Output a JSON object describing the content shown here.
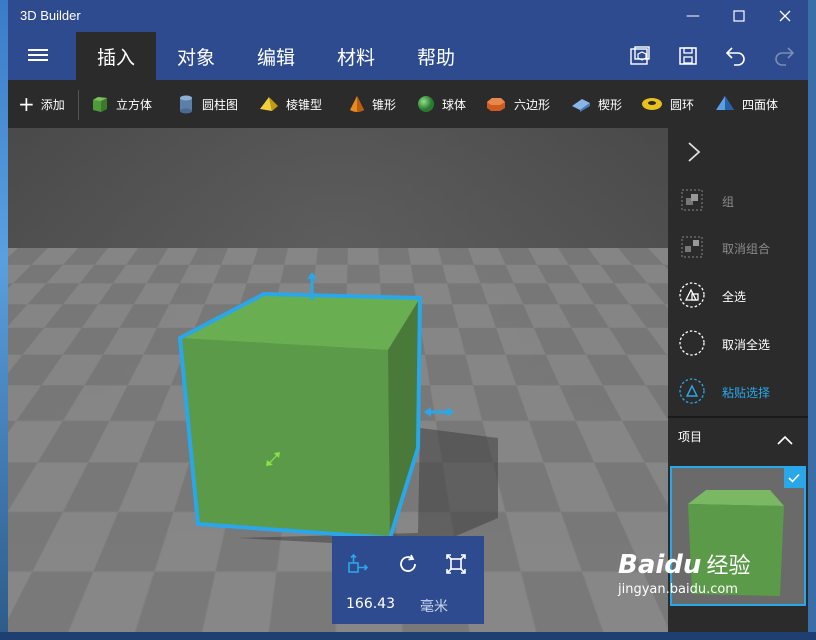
{
  "window": {
    "title": "3D Builder"
  },
  "menu": {
    "tabs": [
      {
        "label": "插入",
        "active": true
      },
      {
        "label": "对象",
        "active": false
      },
      {
        "label": "编辑",
        "active": false
      },
      {
        "label": "材料",
        "active": false
      },
      {
        "label": "帮助",
        "active": false
      }
    ]
  },
  "toolbar": {
    "add_label": "添加",
    "shapes": [
      {
        "label": "立方体",
        "icon": "cube-icon",
        "color": "#4f9a3a"
      },
      {
        "label": "圆柱图",
        "icon": "cylinder-icon",
        "color": "#5b7fa8"
      },
      {
        "label": "棱锥型",
        "icon": "pyramid-icon",
        "color": "#e8c020"
      },
      {
        "label": "锥形",
        "icon": "cone-icon",
        "color": "#e88a20"
      },
      {
        "label": "球体",
        "icon": "sphere-icon",
        "color": "#3aa040"
      },
      {
        "label": "六边形",
        "icon": "hexagon-icon",
        "color": "#d05a20"
      },
      {
        "label": "楔形",
        "icon": "wedge-icon",
        "color": "#6a9ad8"
      },
      {
        "label": "圆环",
        "icon": "torus-icon",
        "color": "#e8c020"
      },
      {
        "label": "四面体",
        "icon": "tetrahedron-icon",
        "color": "#3a80d0"
      }
    ]
  },
  "side_panel": {
    "actions": [
      {
        "label": "组",
        "enabled": false
      },
      {
        "label": "取消组合",
        "enabled": false
      },
      {
        "label": "全选",
        "enabled": true
      },
      {
        "label": "取消全选",
        "enabled": true
      },
      {
        "label": "粘贴选择",
        "enabled": true
      }
    ],
    "items_label": "项目"
  },
  "bottom_panel": {
    "value": "166.43",
    "unit": "毫米"
  },
  "watermark": {
    "brand": "Baidu",
    "text": "经验",
    "url": "jingyan.baidu.com"
  },
  "colors": {
    "accent": "#2aa7e8",
    "titlebar": "#2d4b8e",
    "cube": "#5a9a48"
  }
}
